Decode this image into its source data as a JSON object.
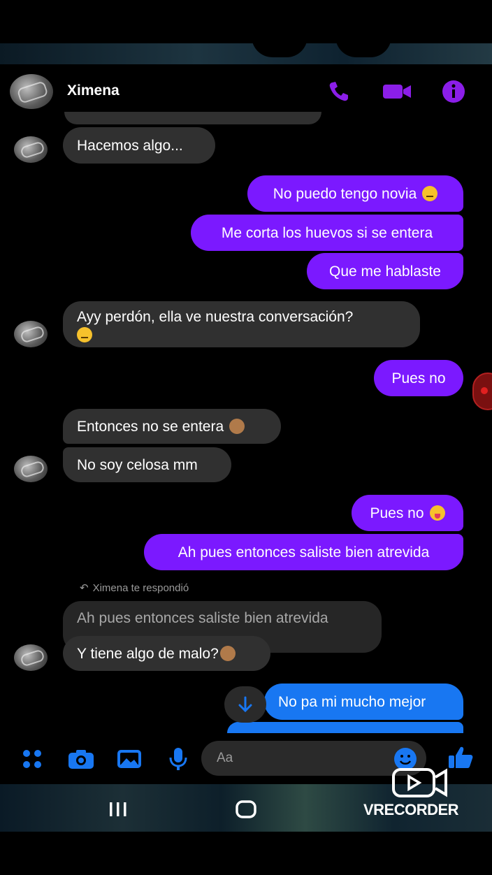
{
  "contact": {
    "name": "Ximena"
  },
  "header_icons": [
    "phone-icon",
    "video-camera-icon",
    "info-icon"
  ],
  "messages": [
    {
      "side": "in",
      "text": "Hacemos algo..."
    },
    {
      "side": "out",
      "text": "No puedo tengo novia",
      "emoji": "confused-face"
    },
    {
      "side": "out",
      "text": "Me corta los huevos si se entera"
    },
    {
      "side": "out",
      "text": "Que me hablaste"
    },
    {
      "side": "in",
      "text": "Ayy perdón, ella ve nuestra conversación?",
      "emoji": "pensive-face"
    },
    {
      "side": "out",
      "text": "Pues no"
    },
    {
      "side": "in",
      "text": "Entonces no se entera",
      "emoji": "speak-no-evil-monkey"
    },
    {
      "side": "in",
      "text": "No soy celosa mm"
    },
    {
      "side": "out",
      "text": "Pues no",
      "emoji": "tongue-face"
    },
    {
      "side": "out",
      "text": "Ah pues entonces saliste bien atrevida"
    },
    {
      "side": "in",
      "text": "Ah pues entonces saliste bien atrevida",
      "quoted": true
    },
    {
      "side": "in",
      "text": "Y tiene algo de malo?",
      "emoji": "see-no-evil-monkey"
    },
    {
      "side": "out",
      "text": "No pa mi mucho mejor"
    }
  ],
  "reply_label": "Ximena te respondió",
  "composer": {
    "placeholder": "Aa",
    "icons": [
      "apps-grid-icon",
      "camera-icon",
      "gallery-icon",
      "microphone-icon",
      "emoji-icon",
      "thumbs-up-icon"
    ]
  },
  "navigation": {
    "icons": [
      "recent-apps-icon",
      "home-icon"
    ]
  },
  "watermark": {
    "text": "VRECORDER"
  },
  "colors": {
    "outgoing": "#7b19ff",
    "incoming": "#303030",
    "latest": "#1877f2",
    "accent_icons": "#8b1ee8",
    "composer_icons": "#1877f2"
  }
}
